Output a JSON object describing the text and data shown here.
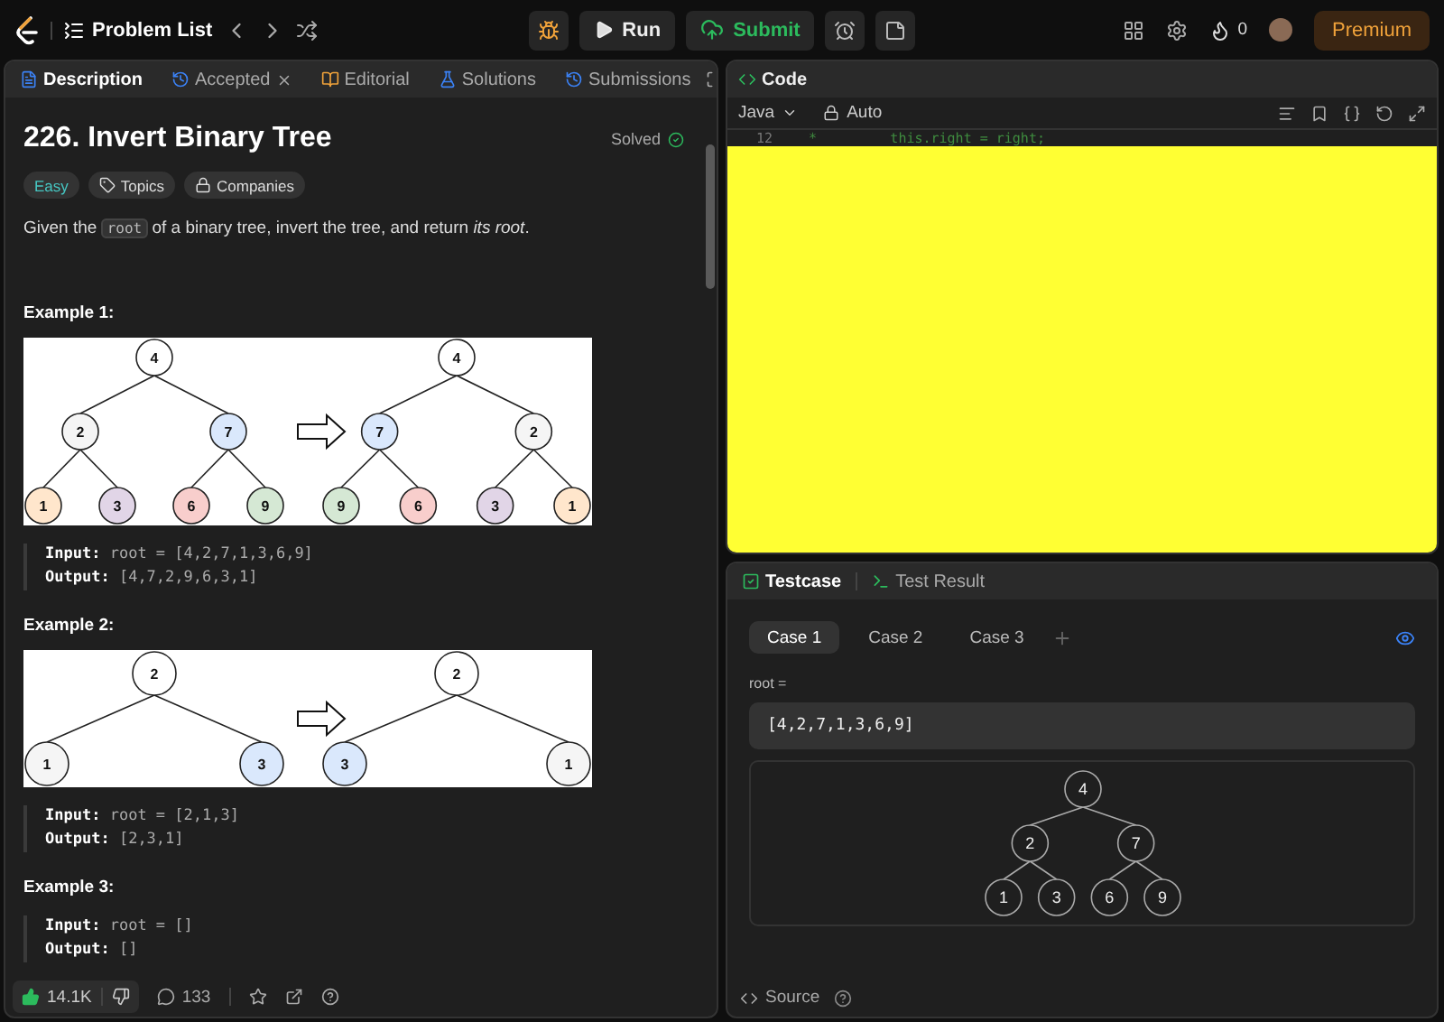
{
  "topbar": {
    "problem_list": "Problem List",
    "run": "Run",
    "submit": "Submit",
    "streak": "0",
    "premium": "Premium"
  },
  "desc_tabs": [
    {
      "label": "Description",
      "selected": true,
      "closable": false
    },
    {
      "label": "Accepted",
      "selected": false,
      "closable": true
    },
    {
      "label": "Editorial",
      "selected": false,
      "closable": false
    },
    {
      "label": "Solutions",
      "selected": false,
      "closable": false
    },
    {
      "label": "Submissions",
      "selected": false,
      "closable": false
    }
  ],
  "problem": {
    "title": "226. Invert Binary Tree",
    "status": "Solved",
    "tags": [
      {
        "label": "Easy",
        "kind": "difficulty"
      },
      {
        "label": "Topics",
        "kind": "topics"
      },
      {
        "label": "Companies",
        "kind": "companies"
      }
    ],
    "statement": [
      {
        "kind": "text",
        "text": "Given the "
      },
      {
        "kind": "code",
        "text": "root"
      },
      {
        "kind": "text",
        "text": " of a binary tree, invert the tree, and return *its root*."
      }
    ]
  },
  "examples": [
    {
      "title": "Example 1:",
      "trees": [
        [
          {
            "value": "4",
            "color": "#ffffff"
          },
          {
            "value": "2",
            "color": "#f5f5f5"
          },
          {
            "value": "7",
            "color": "#dae8fc"
          },
          {
            "value": "1",
            "color": "#ffe6cc"
          },
          {
            "value": "3",
            "color": "#e1d5e7"
          },
          {
            "value": "6",
            "color": "#f8cecc"
          },
          {
            "value": "9",
            "color": "#d5e8d4"
          }
        ],
        [
          {
            "value": "4",
            "color": "#ffffff"
          },
          {
            "value": "7",
            "color": "#dae8fc"
          },
          {
            "value": "2",
            "color": "#f5f5f5"
          },
          {
            "value": "9",
            "color": "#d5e8d4"
          },
          {
            "value": "6",
            "color": "#f8cecc"
          },
          {
            "value": "3",
            "color": "#e1d5e7"
          },
          {
            "value": "1",
            "color": "#ffe6cc"
          }
        ]
      ],
      "input_label": "Input:",
      "input": "root = [4,2,7,1,3,6,9]",
      "output_label": "Output:",
      "output": "[4,7,2,9,6,3,1]"
    },
    {
      "title": "Example 2:",
      "trees": [
        [
          {
            "value": "2",
            "color": "#ffffff"
          },
          {
            "value": "1",
            "color": "#f5f5f5"
          },
          {
            "value": "3",
            "color": "#dae8fc"
          }
        ],
        [
          {
            "value": "2",
            "color": "#ffffff"
          },
          {
            "value": "3",
            "color": "#dae8fc"
          },
          {
            "value": "1",
            "color": "#f5f5f5"
          }
        ]
      ],
      "input_label": "Input:",
      "input": "root = [2,1,3]",
      "output_label": "Output:",
      "output": "[2,3,1]"
    },
    {
      "title": "Example 3:",
      "input_label": "Input:",
      "input": "root = []",
      "output_label": "Output:",
      "output": "[]"
    }
  ],
  "description_footer": {
    "likes": "14.1K",
    "comments": "133"
  },
  "code": {
    "title": "Code",
    "language": "Java",
    "mode": "Auto",
    "lines": [
      {
        "number": "12",
        "text": "*         this.right = right;"
      }
    ]
  },
  "testcase": {
    "tabs": [
      {
        "label": "Testcase",
        "selected": true
      },
      {
        "label": "Test Result",
        "selected": false
      }
    ],
    "cases": [
      {
        "label": "Case 1",
        "selected": true
      },
      {
        "label": "Case 2",
        "selected": false
      },
      {
        "label": "Case 3",
        "selected": false
      }
    ],
    "param_label": "root =",
    "value": "[4,2,7,1,3,6,9]",
    "tree": [
      "4",
      "2",
      "7",
      "1",
      "3",
      "6",
      "9"
    ],
    "source": "Source"
  }
}
